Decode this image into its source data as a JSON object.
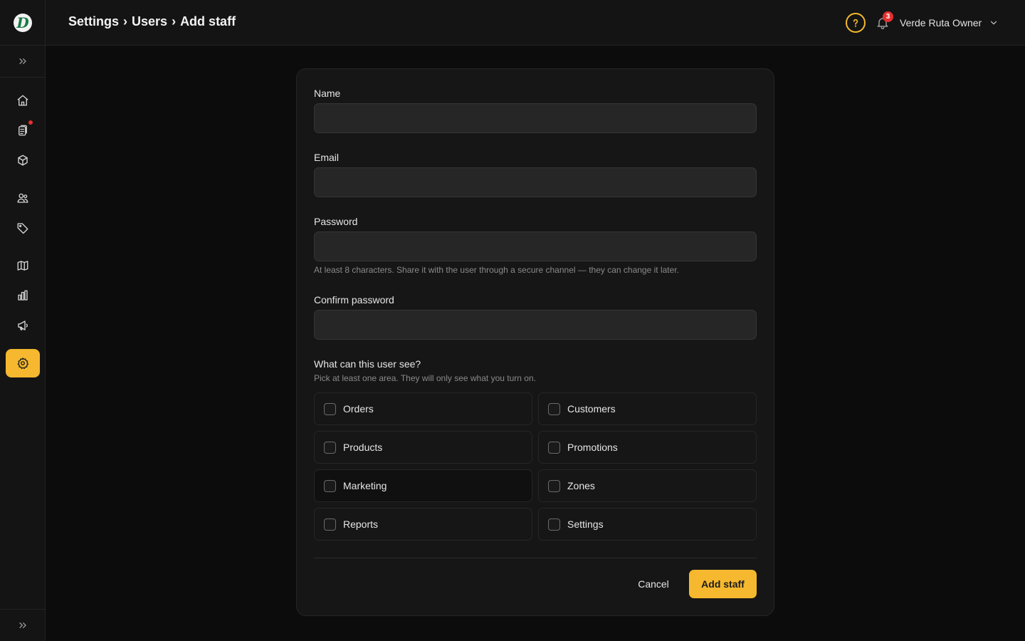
{
  "header": {
    "breadcrumb": [
      "Settings",
      "Users",
      "Add staff"
    ],
    "separator": "›",
    "notifications_count": "3",
    "user_name": "Verde Ruta Owner"
  },
  "logo": {
    "letter": "D"
  },
  "sidebar": {
    "items": [
      {
        "icon": "home-icon"
      },
      {
        "icon": "clipboard-icon",
        "has_dot": true
      },
      {
        "icon": "box-icon"
      },
      {
        "icon": "users-icon"
      },
      {
        "icon": "tag-icon"
      },
      {
        "icon": "map-icon"
      },
      {
        "icon": "bar-chart-icon"
      },
      {
        "icon": "megaphone-icon"
      },
      {
        "icon": "gear-icon",
        "active": true
      }
    ]
  },
  "form": {
    "name_label": "Name",
    "name_value": "",
    "email_label": "Email",
    "email_value": "",
    "password_label": "Password",
    "password_value": "",
    "password_hint": "At least 8 characters. Share it with the user through a secure channel — they can change it later.",
    "confirm_label": "Confirm password",
    "confirm_value": "",
    "permissions_title": "What can this user see?",
    "permissions_subtitle": "Pick at least one area. They will only see what you turn on.",
    "permissions": [
      {
        "label": "Orders",
        "checked": false
      },
      {
        "label": "Customers",
        "checked": false
      },
      {
        "label": "Products",
        "checked": false
      },
      {
        "label": "Promotions",
        "checked": false
      },
      {
        "label": "Marketing",
        "checked": false
      },
      {
        "label": "Zones",
        "checked": false
      },
      {
        "label": "Reports",
        "checked": false
      },
      {
        "label": "Settings",
        "checked": false
      }
    ],
    "cancel_label": "Cancel",
    "submit_label": "Add staff"
  },
  "colors": {
    "accent": "#f5b82e",
    "badge": "#e5302f",
    "background": "#0c0c0c",
    "surface": "#161616"
  }
}
